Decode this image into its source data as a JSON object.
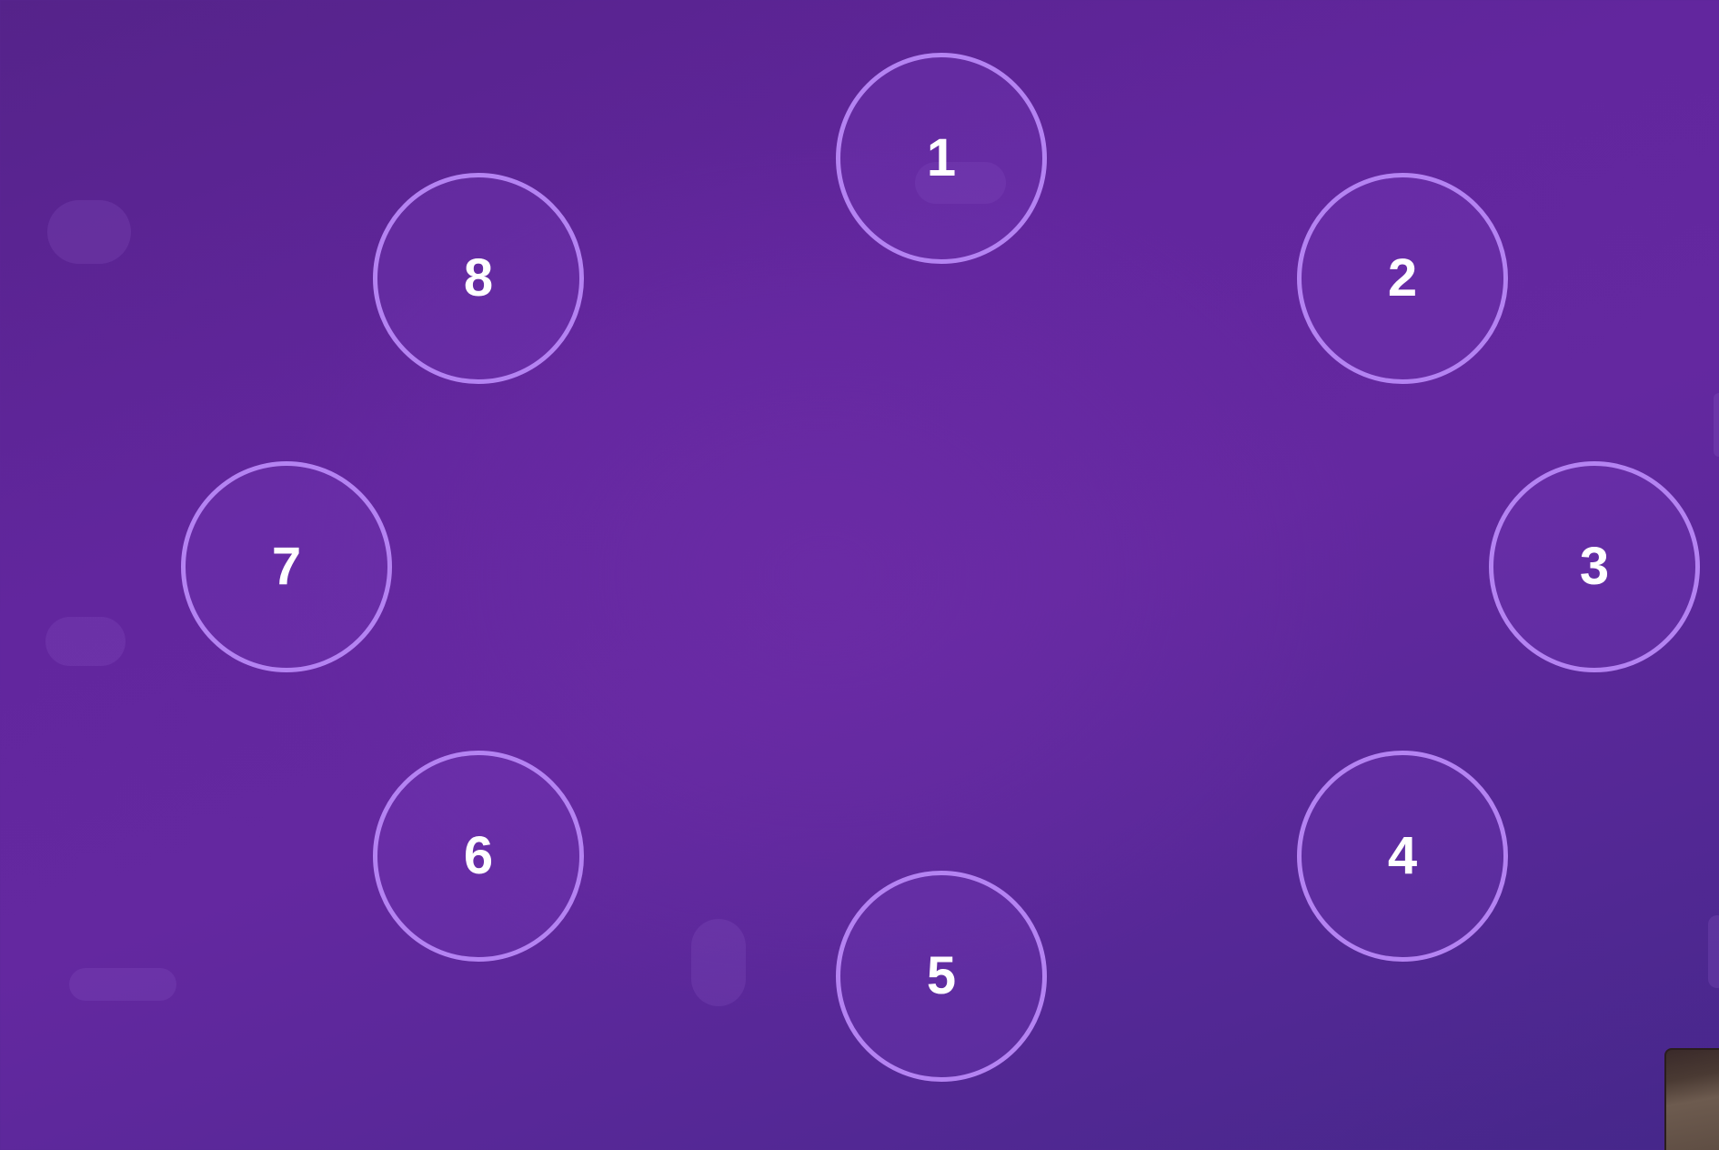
{
  "dial": {
    "buttons": [
      {
        "label": "1"
      },
      {
        "label": "2"
      },
      {
        "label": "3"
      },
      {
        "label": "4"
      },
      {
        "label": "5"
      },
      {
        "label": "6"
      },
      {
        "label": "7"
      },
      {
        "label": "8"
      }
    ]
  },
  "colors": {
    "background": "#5f259b",
    "ring_border": "#b483f2",
    "label_text": "#ffffff"
  }
}
